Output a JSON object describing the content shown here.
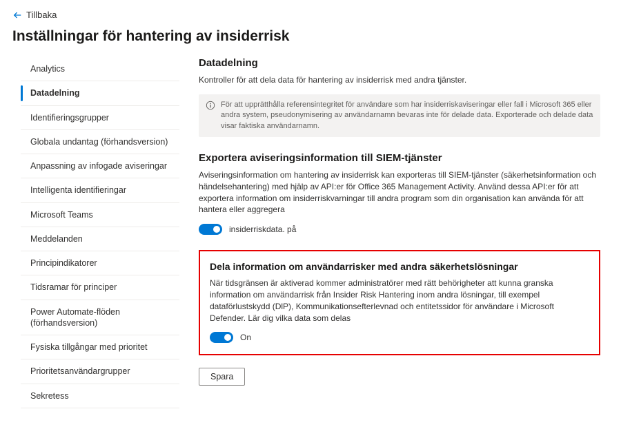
{
  "back_label": "Tillbaka",
  "page_title": "Inställningar för hantering av insiderrisk",
  "sidebar": {
    "items": [
      {
        "label": "Analytics"
      },
      {
        "label": "Datadelning"
      },
      {
        "label": "Identifieringsgrupper"
      },
      {
        "label": "Globala undantag (förhandsversion)"
      },
      {
        "label": "Anpassning av infogade aviseringar"
      },
      {
        "label": "Intelligenta identifieringar"
      },
      {
        "label": "Microsoft Teams"
      },
      {
        "label": "Meddelanden"
      },
      {
        "label": "Principindikatorer"
      },
      {
        "label": "Tidsramar för principer"
      },
      {
        "label": "Power Automate-flöden (förhandsversion)"
      },
      {
        "label": "Fysiska tillgångar med prioritet"
      },
      {
        "label": "Prioritetsanvändargrupper"
      },
      {
        "label": "Sekretess"
      }
    ],
    "active_index": 1
  },
  "content": {
    "section1": {
      "title": "Datadelning",
      "sub": "Kontroller för att dela data för hantering av insiderrisk med andra tjänster.",
      "info": "För att upprätthålla referensintegritet för användare som har insiderriskaviseringar eller fall i Microsoft 365 eller andra system, pseudonymisering av användarnamn bevaras inte för delade data. Exporterade och delade data visar faktiska användarnamn."
    },
    "section2": {
      "title": "Exportera aviseringsinformation till SIEM-tjänster",
      "desc": "Aviseringsinformation om hantering av insiderrisk kan exporteras till SIEM-tjänster (säkerhetsinformation och händelsehantering) med hjälp av API:er för Office 365 Management Activity. Använd dessa API:er för att exportera information om insiderriskvarningar till andra program som din organisation kan använda för att hantera eller aggregera",
      "toggle_label": "insiderriskdata. på"
    },
    "section3": {
      "title": "Dela information om användarrisker med andra säkerhetslösningar",
      "desc": "När tidsgränsen är aktiverad kommer administratörer med rätt behörigheter att kunna granska information om användarrisk från Insider Risk Hantering inom andra lösningar, till exempel dataförlustskydd (DlP), Kommunikationsefterlevnad och entitetssidor för användare i Microsoft Defender. Lär dig vilka data som delas",
      "toggle_label": "On"
    },
    "save_label": "Spara"
  }
}
